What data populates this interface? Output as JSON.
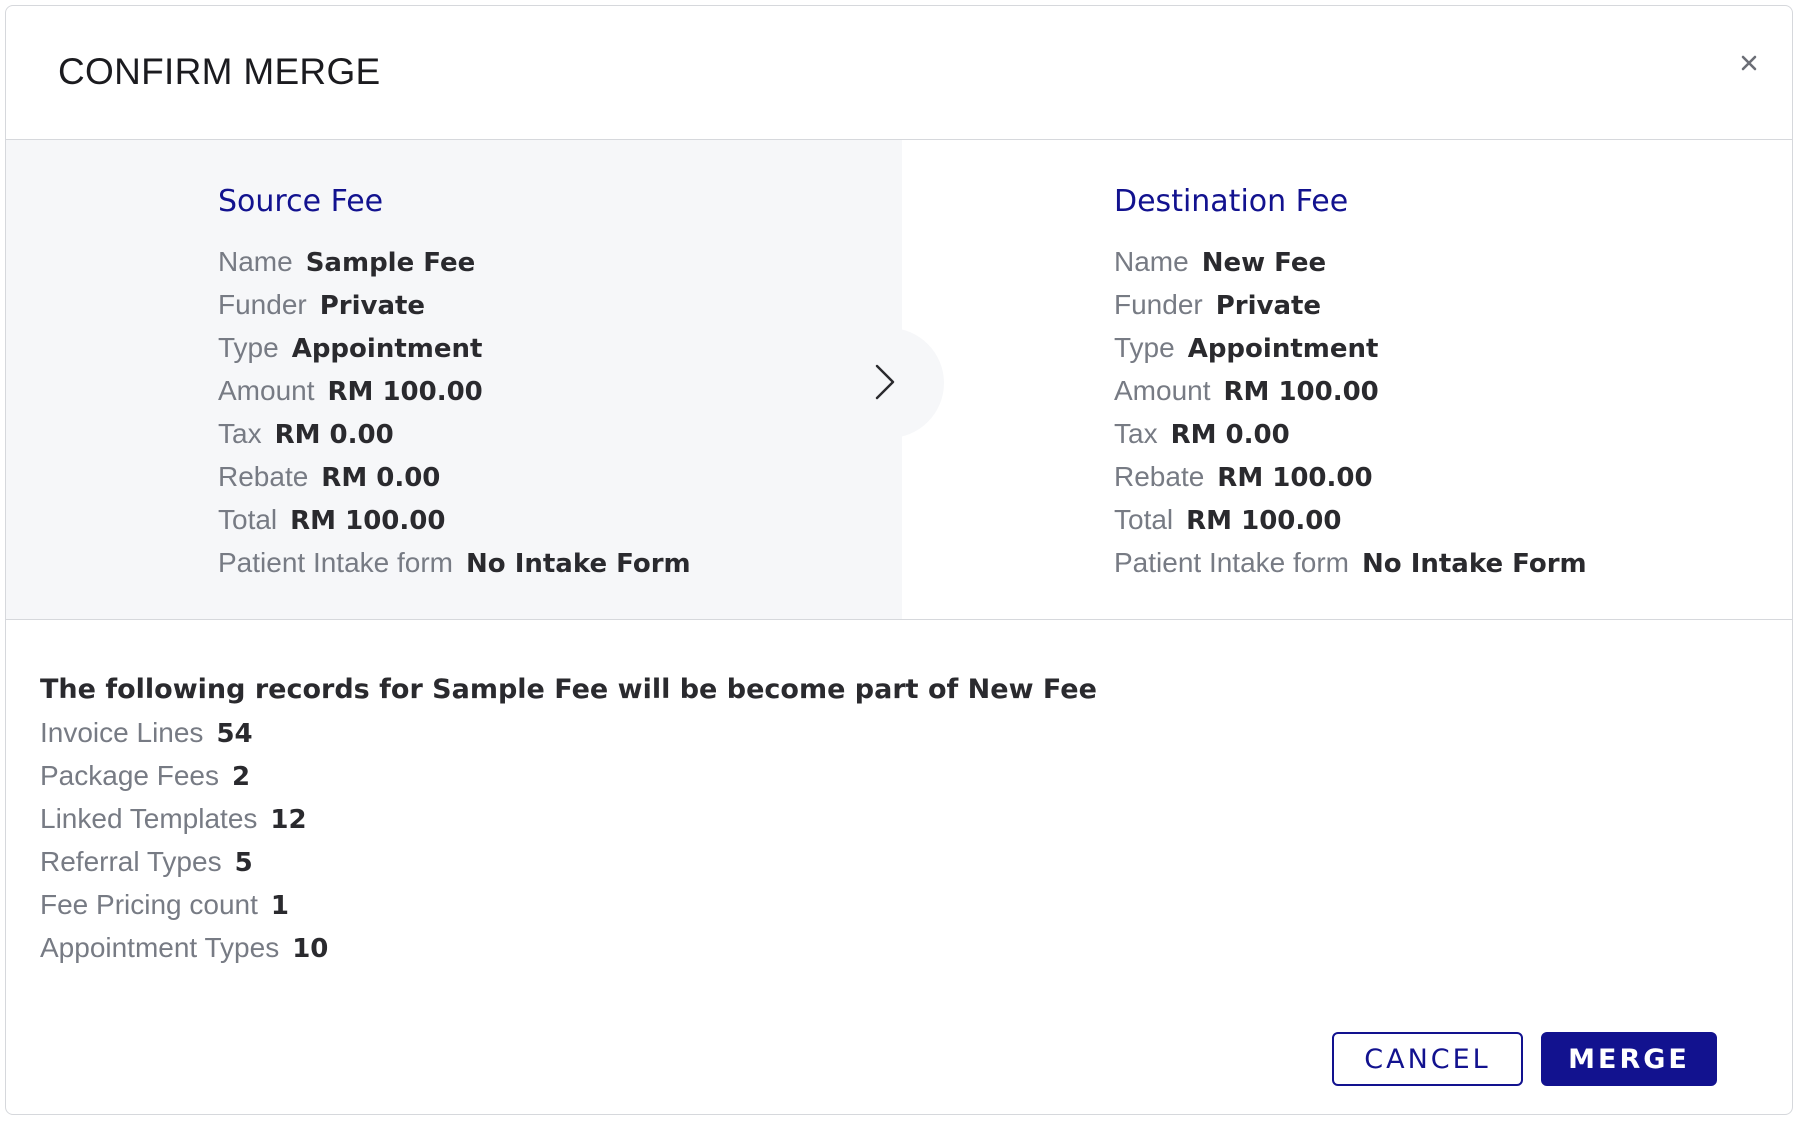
{
  "dialog": {
    "title": "CONFIRM MERGE",
    "close_icon": "close-icon"
  },
  "source": {
    "heading": "Source Fee",
    "fields": [
      {
        "label": "Name",
        "value": "Sample Fee"
      },
      {
        "label": "Funder",
        "value": "Private"
      },
      {
        "label": "Type",
        "value": "Appointment"
      },
      {
        "label": "Amount",
        "value": "RM 100.00"
      },
      {
        "label": "Tax",
        "value": "RM 0.00"
      },
      {
        "label": "Rebate",
        "value": "RM 0.00"
      },
      {
        "label": "Total",
        "value": "RM 100.00"
      },
      {
        "label": "Patient Intake form",
        "value": "No Intake Form"
      }
    ]
  },
  "destination": {
    "heading": "Destination Fee",
    "fields": [
      {
        "label": "Name",
        "value": "New Fee"
      },
      {
        "label": "Funder",
        "value": "Private"
      },
      {
        "label": "Type",
        "value": "Appointment"
      },
      {
        "label": "Amount",
        "value": "RM 100.00"
      },
      {
        "label": "Tax",
        "value": "RM 0.00"
      },
      {
        "label": "Rebate",
        "value": "RM 100.00"
      },
      {
        "label": "Total",
        "value": "RM 100.00"
      },
      {
        "label": "Patient Intake form",
        "value": "No Intake Form"
      }
    ]
  },
  "arrow_icon": "chevron-right-icon",
  "records": {
    "heading": "The following records for Sample Fee will be become part of New Fee",
    "items": [
      {
        "label": "Invoice Lines",
        "value": "54"
      },
      {
        "label": "Package Fees",
        "value": "2"
      },
      {
        "label": "Linked Templates",
        "value": "12"
      },
      {
        "label": "Referral Types",
        "value": "5"
      },
      {
        "label": "Fee Pricing count",
        "value": "1"
      },
      {
        "label": "Appointment Types",
        "value": "10"
      }
    ]
  },
  "actions": {
    "cancel_label": "CANCEL",
    "merge_label": "MERGE"
  },
  "colors": {
    "accent": "#12128f",
    "label_gray": "#777b84",
    "value_dark": "#2a2a2e",
    "panel_bg": "#f6f7f9"
  }
}
